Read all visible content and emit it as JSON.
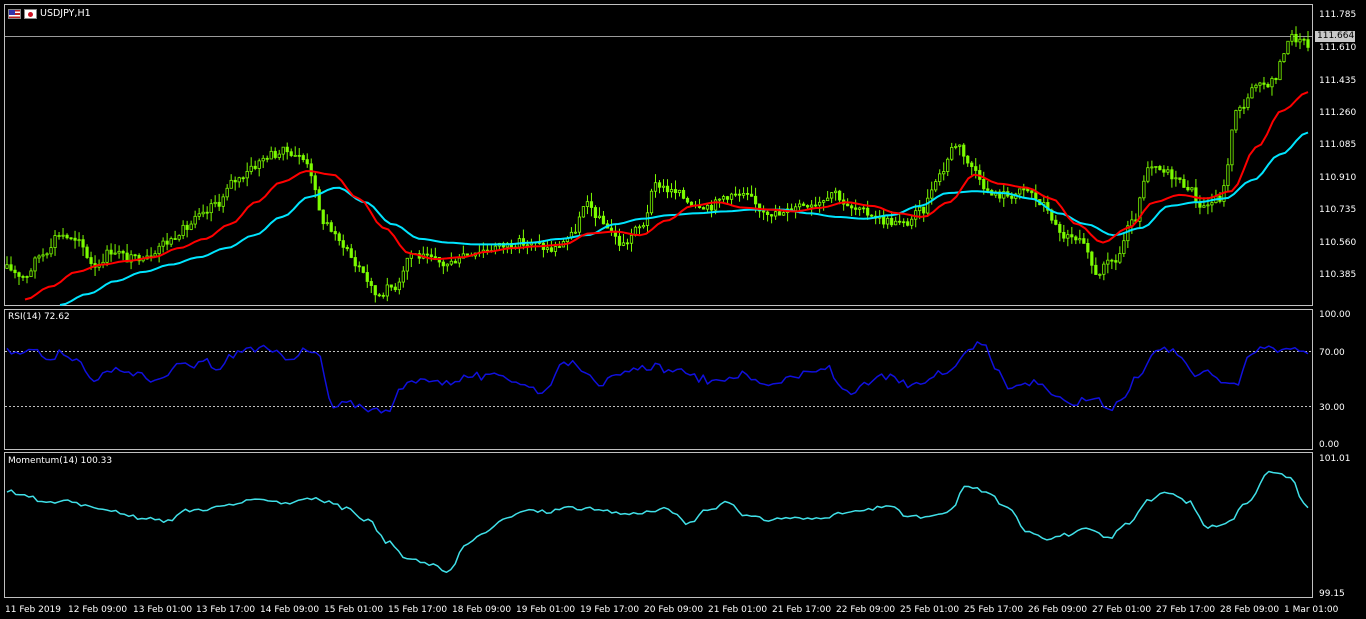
{
  "window": {
    "symbol_label": "USDJPY,H1",
    "icons": [
      "us-flag-icon",
      "jp-flag-icon"
    ]
  },
  "colors": {
    "background": "#000000",
    "panel_border": "#c0c0c0",
    "candle": "#7CFC00",
    "ma_fast": "#ff0000",
    "ma_slow": "#00e5ff",
    "rsi_line": "#1010dd",
    "momentum_line": "#40e0e8",
    "current_price_tag_bg": "#c8c8c8"
  },
  "price_panel": {
    "current_price": "111.664",
    "y_ticks": [
      "111.785",
      "111.610",
      "111.435",
      "111.260",
      "111.085",
      "110.910",
      "110.735",
      "110.560",
      "110.385"
    ],
    "ylim": [
      110.24,
      111.88
    ]
  },
  "rsi_panel": {
    "title": "RSI(14) 72.62",
    "y_ticks": [
      "100.00",
      "70.00",
      "30.00",
      "0.00"
    ],
    "levels": [
      70,
      30
    ],
    "ylim": [
      0,
      100
    ]
  },
  "momentum_panel": {
    "title": "Momentum(14) 100.33",
    "y_ticks": [
      "101.01",
      "99.15"
    ],
    "ylim": [
      99.15,
      101.01
    ]
  },
  "time_axis": {
    "labels": [
      "11 Feb 2019",
      "12 Feb 09:00",
      "13 Feb 01:00",
      "13 Feb 17:00",
      "14 Feb 09:00",
      "15 Feb 01:00",
      "15 Feb 17:00",
      "18 Feb 09:00",
      "19 Feb 01:00",
      "19 Feb 17:00",
      "20 Feb 09:00",
      "21 Feb 01:00",
      "21 Feb 17:00",
      "22 Feb 09:00",
      "25 Feb 01:00",
      "25 Feb 17:00",
      "26 Feb 09:00",
      "27 Feb 01:00",
      "27 Feb 17:00",
      "28 Feb 09:00",
      "1 Mar 01:00"
    ]
  },
  "chart_data": [
    {
      "type": "candlestick",
      "title": "USDJPY,H1",
      "y_ticks": [
        111.785,
        111.61,
        111.435,
        111.26,
        111.085,
        110.91,
        110.735,
        110.56,
        110.385
      ],
      "close_anchors": [
        110.44,
        110.4,
        110.52,
        110.63,
        110.58,
        110.46,
        110.54,
        110.49,
        110.52,
        110.58,
        110.65,
        110.72,
        110.8,
        110.92,
        111.0,
        111.06,
        111.08,
        111.03,
        110.7,
        110.58,
        110.45,
        110.3,
        110.34,
        110.52,
        110.49,
        110.46,
        110.52,
        110.54,
        110.56,
        110.58,
        110.57,
        110.54,
        110.61,
        110.78,
        110.68,
        110.57,
        110.66,
        110.9,
        110.85,
        110.8,
        110.78,
        110.84,
        110.83,
        110.76,
        110.73,
        110.79,
        110.8,
        110.86,
        110.76,
        110.74,
        110.7,
        110.68,
        110.75,
        110.95,
        111.12,
        110.98,
        110.84,
        110.84,
        110.86,
        110.78,
        110.62,
        110.58,
        110.42,
        110.48,
        110.68,
        110.98,
        110.96,
        110.9,
        110.78,
        110.82,
        111.3,
        111.42,
        111.46,
        111.7,
        111.66
      ],
      "ma_fast_anchors": [
        110.27,
        110.34,
        110.42,
        110.46,
        110.48,
        110.5,
        110.55,
        110.6,
        110.68,
        110.8,
        110.91,
        110.97,
        110.95,
        110.82,
        110.66,
        110.52,
        110.49,
        110.5,
        110.53,
        110.55,
        110.56,
        110.57,
        110.63,
        110.64,
        110.62,
        110.7,
        110.78,
        110.8,
        110.77,
        110.76,
        110.75,
        110.77,
        110.8,
        110.78,
        110.74,
        110.72,
        110.8,
        110.95,
        110.9,
        110.88,
        110.82,
        110.68,
        110.58,
        110.66,
        110.8,
        110.84,
        110.82,
        110.86,
        111.1,
        111.3,
        111.4
      ],
      "ma_slow_anchors": [
        110.24,
        110.3,
        110.37,
        110.42,
        110.46,
        110.5,
        110.55,
        110.62,
        110.72,
        110.83,
        110.88,
        110.8,
        110.68,
        110.6,
        110.58,
        110.57,
        110.57,
        110.58,
        110.6,
        110.62,
        110.68,
        110.71,
        110.73,
        110.74,
        110.75,
        110.76,
        110.76,
        110.74,
        110.72,
        110.71,
        110.73,
        110.78,
        110.85,
        110.86,
        110.85,
        110.82,
        110.74,
        110.68,
        110.62,
        110.66,
        110.78,
        110.8,
        110.82,
        110.92,
        111.06,
        111.18
      ]
    },
    {
      "type": "line",
      "title": "RSI(14) 72.62",
      "ylim": [
        0,
        100
      ],
      "values": [
        72,
        70,
        74,
        68,
        72,
        65,
        52,
        55,
        58,
        56,
        52,
        50,
        62,
        60,
        65,
        58,
        70,
        74,
        74,
        70,
        68,
        72,
        70,
        30,
        33,
        32,
        28,
        30,
        45,
        50,
        52,
        48,
        52,
        54,
        52,
        55,
        50,
        45,
        42,
        60,
        65,
        58,
        48,
        52,
        56,
        60,
        62,
        55,
        58,
        52,
        48,
        53,
        55,
        50,
        48,
        52,
        54,
        56,
        60,
        45,
        42,
        48,
        54,
        50,
        45,
        50,
        56,
        62,
        75,
        78,
        60,
        45,
        48,
        50,
        40,
        32,
        35,
        38,
        30,
        38,
        55,
        70,
        74,
        68,
        56,
        58,
        50,
        48,
        70,
        76,
        74,
        75,
        72
      ]
    },
    {
      "type": "line",
      "title": "Momentum(14) 100.33",
      "ylim": [
        99.15,
        101.01
      ],
      "values": [
        100.55,
        100.47,
        100.38,
        100.42,
        100.35,
        100.3,
        100.2,
        100.16,
        100.14,
        100.28,
        100.3,
        100.35,
        100.4,
        100.43,
        100.38,
        100.45,
        100.4,
        100.3,
        100.15,
        99.85,
        99.62,
        99.55,
        99.45,
        99.82,
        100.0,
        100.18,
        100.28,
        100.26,
        100.32,
        100.3,
        100.26,
        100.23,
        100.26,
        100.3,
        100.1,
        100.28,
        100.4,
        100.2,
        100.15,
        100.18,
        100.16,
        100.2,
        100.25,
        100.28,
        100.35,
        100.2,
        100.18,
        100.25,
        100.62,
        100.52,
        100.3,
        100.0,
        99.9,
        99.95,
        100.02,
        99.9,
        100.1,
        100.42,
        100.52,
        100.4,
        100.05,
        100.12,
        100.4,
        100.8,
        100.75,
        100.33
      ]
    }
  ]
}
